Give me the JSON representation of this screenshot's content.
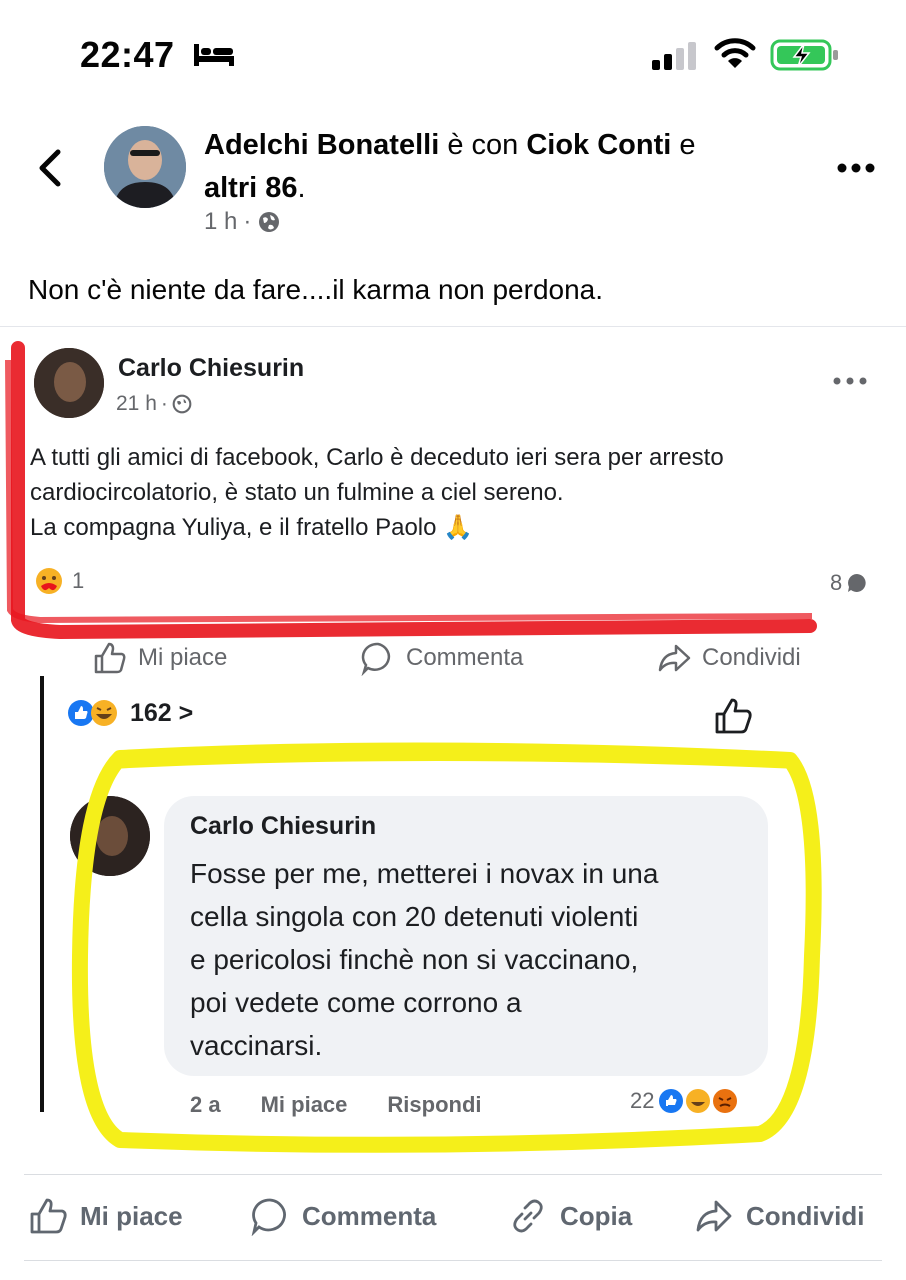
{
  "status_bar": {
    "time": "22:47"
  },
  "post": {
    "author": "Adelchi Bonatelli",
    "with_text": " è con ",
    "tagged": "Ciok Conti",
    "and_text": " e",
    "others": "altri 86",
    "period": ".",
    "time": "1 h",
    "sep": "·",
    "caption": "Non c'è niente da fare....il karma non perdona."
  },
  "shared": {
    "author": "Carlo Chiesurin",
    "time": "21 h",
    "sep": "·",
    "body_line1": "A tutti gli amici di facebook, Carlo è deceduto ieri sera per arresto",
    "body_line2": "cardiocircolatorio, è stato un fulmine a ciel sereno.",
    "body_line3": "La compagna Yuliya, e il fratello Paolo 🙏",
    "reaction_count": "1",
    "comment_count": "8",
    "actions": {
      "like": "Mi piace",
      "comment": "Commenta",
      "share": "Condividi"
    },
    "likes_count": "162 >",
    "comment": {
      "author": "Carlo Chiesurin",
      "line1": "Fosse per me, metterei i novax in una",
      "line2": "cella singola con 20 detenuti violenti",
      "line3": "e pericolosi finchè non si vaccinano,",
      "line4": "poi vedete come corrono a",
      "line5": "vaccinarsi.",
      "age": "2 a",
      "like": "Mi piace",
      "reply": "Rispondi",
      "reaction_count": "22"
    }
  },
  "actions": {
    "like": "Mi piace",
    "comment": "Commenta",
    "copy": "Copia",
    "share": "Condividi"
  },
  "colors": {
    "text": "#050505",
    "muted": "#65676b",
    "fb_blue": "#1877f2",
    "highlight_red": "#e8141c",
    "highlight_yellow": "#f5ef1a"
  }
}
